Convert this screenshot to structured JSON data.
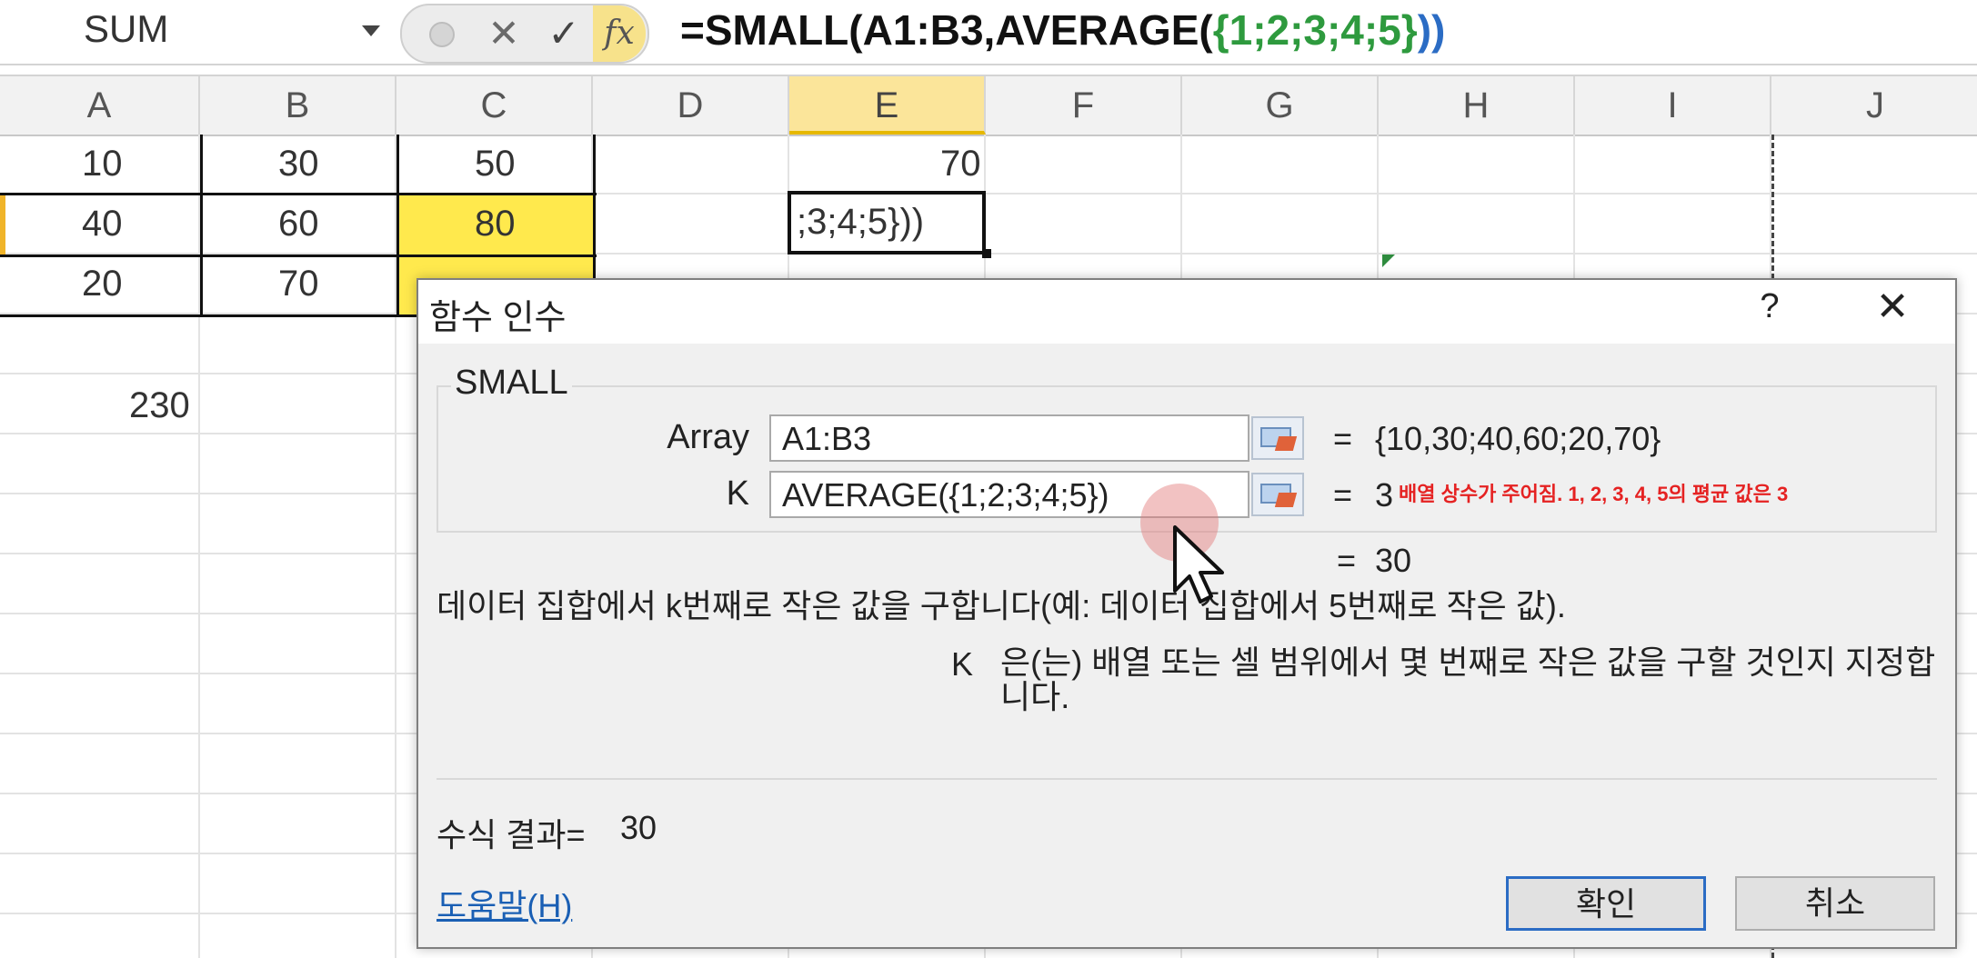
{
  "formula_bar": {
    "name_box": "SUM",
    "cancel_icon": "close-icon",
    "enter_icon": "check-icon",
    "fx_label": "fx",
    "formula_part1": "=SMALL(A1:B3,AVERAGE(",
    "formula_part2": "{1;2;3;4;5}",
    "formula_part3": "))"
  },
  "columns": [
    "A",
    "B",
    "C",
    "D",
    "E",
    "F",
    "G",
    "H",
    "I",
    "J"
  ],
  "selected_column": "E",
  "cells": {
    "A1": "10",
    "B1": "30",
    "C1": "50",
    "E1": "70",
    "A2": "40",
    "B2": "60",
    "C2": "80",
    "A3": "20",
    "B3": "70",
    "A5": "230"
  },
  "active_cell_text": ";3;4;5}))",
  "colors": {
    "highlight_yellow": "#ffe94d",
    "selected_header": "#fbe59a",
    "annotation_red": "#e52222",
    "link_blue": "#1a5fb4"
  },
  "dialog": {
    "title": "함수 인수",
    "help_button": "?",
    "close_button": "X",
    "function_name": "SMALL",
    "args": [
      {
        "label": "Array",
        "value": "A1:B3",
        "equals": "=",
        "result": "{10,30;40,60;20,70}"
      },
      {
        "label": "K",
        "value": "AVERAGE({1;2;3;4;5})",
        "equals": "=",
        "result": "3"
      }
    ],
    "annotation": "배열 상수가 주어짐. 1, 2, 3, 4, 5의 평균 값은 3",
    "overall_equals": "=",
    "overall_result": "30",
    "description": "데이터 집합에서 k번째로 작은 값을 구합니다(예: 데이터 집합에서 5번째로 작은 값).",
    "arg_help_name": "K",
    "arg_help_text": "은(는) 배열 또는 셀 범위에서 몇 번째로 작은 값을 구할 것인지 지정합니다.",
    "result_label": "수식 결과=",
    "result_value": "30",
    "help_link": "도움말(H)",
    "ok_button": "확인",
    "cancel_button": "취소"
  }
}
